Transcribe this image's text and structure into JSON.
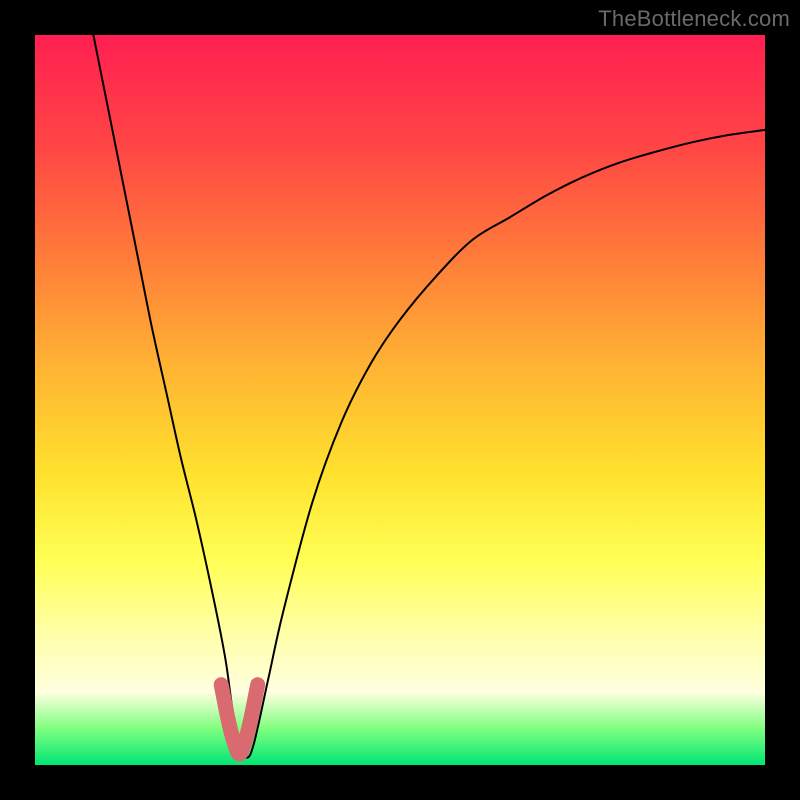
{
  "watermark": "TheBottleneck.com",
  "chart_data": {
    "type": "line",
    "title": "",
    "xlabel": "",
    "ylabel": "",
    "xlim": [
      0,
      100
    ],
    "ylim": [
      0,
      100
    ],
    "series": [
      {
        "name": "bottleneck-curve",
        "x": [
          8,
          10,
          12,
          14,
          16,
          18,
          20,
          22,
          24,
          26,
          27,
          28,
          29,
          30,
          32,
          34,
          38,
          42,
          46,
          50,
          55,
          60,
          65,
          70,
          75,
          80,
          85,
          90,
          95,
          100
        ],
        "values": [
          100,
          90,
          80,
          70,
          60,
          51,
          42,
          34,
          25,
          15,
          8,
          3,
          1,
          3,
          12,
          21,
          36,
          47,
          55,
          61,
          67,
          72,
          75,
          78,
          80.5,
          82.5,
          84,
          85.3,
          86.3,
          87
        ]
      },
      {
        "name": "bottleneck-highlight",
        "x": [
          25.5,
          26.5,
          27.3,
          28,
          28.7,
          29.5,
          30.5
        ],
        "values": [
          11,
          6,
          3,
          1.5,
          3,
          6,
          11
        ]
      }
    ],
    "highlight_color": "#d96a6f",
    "curve_color": "#000000"
  }
}
